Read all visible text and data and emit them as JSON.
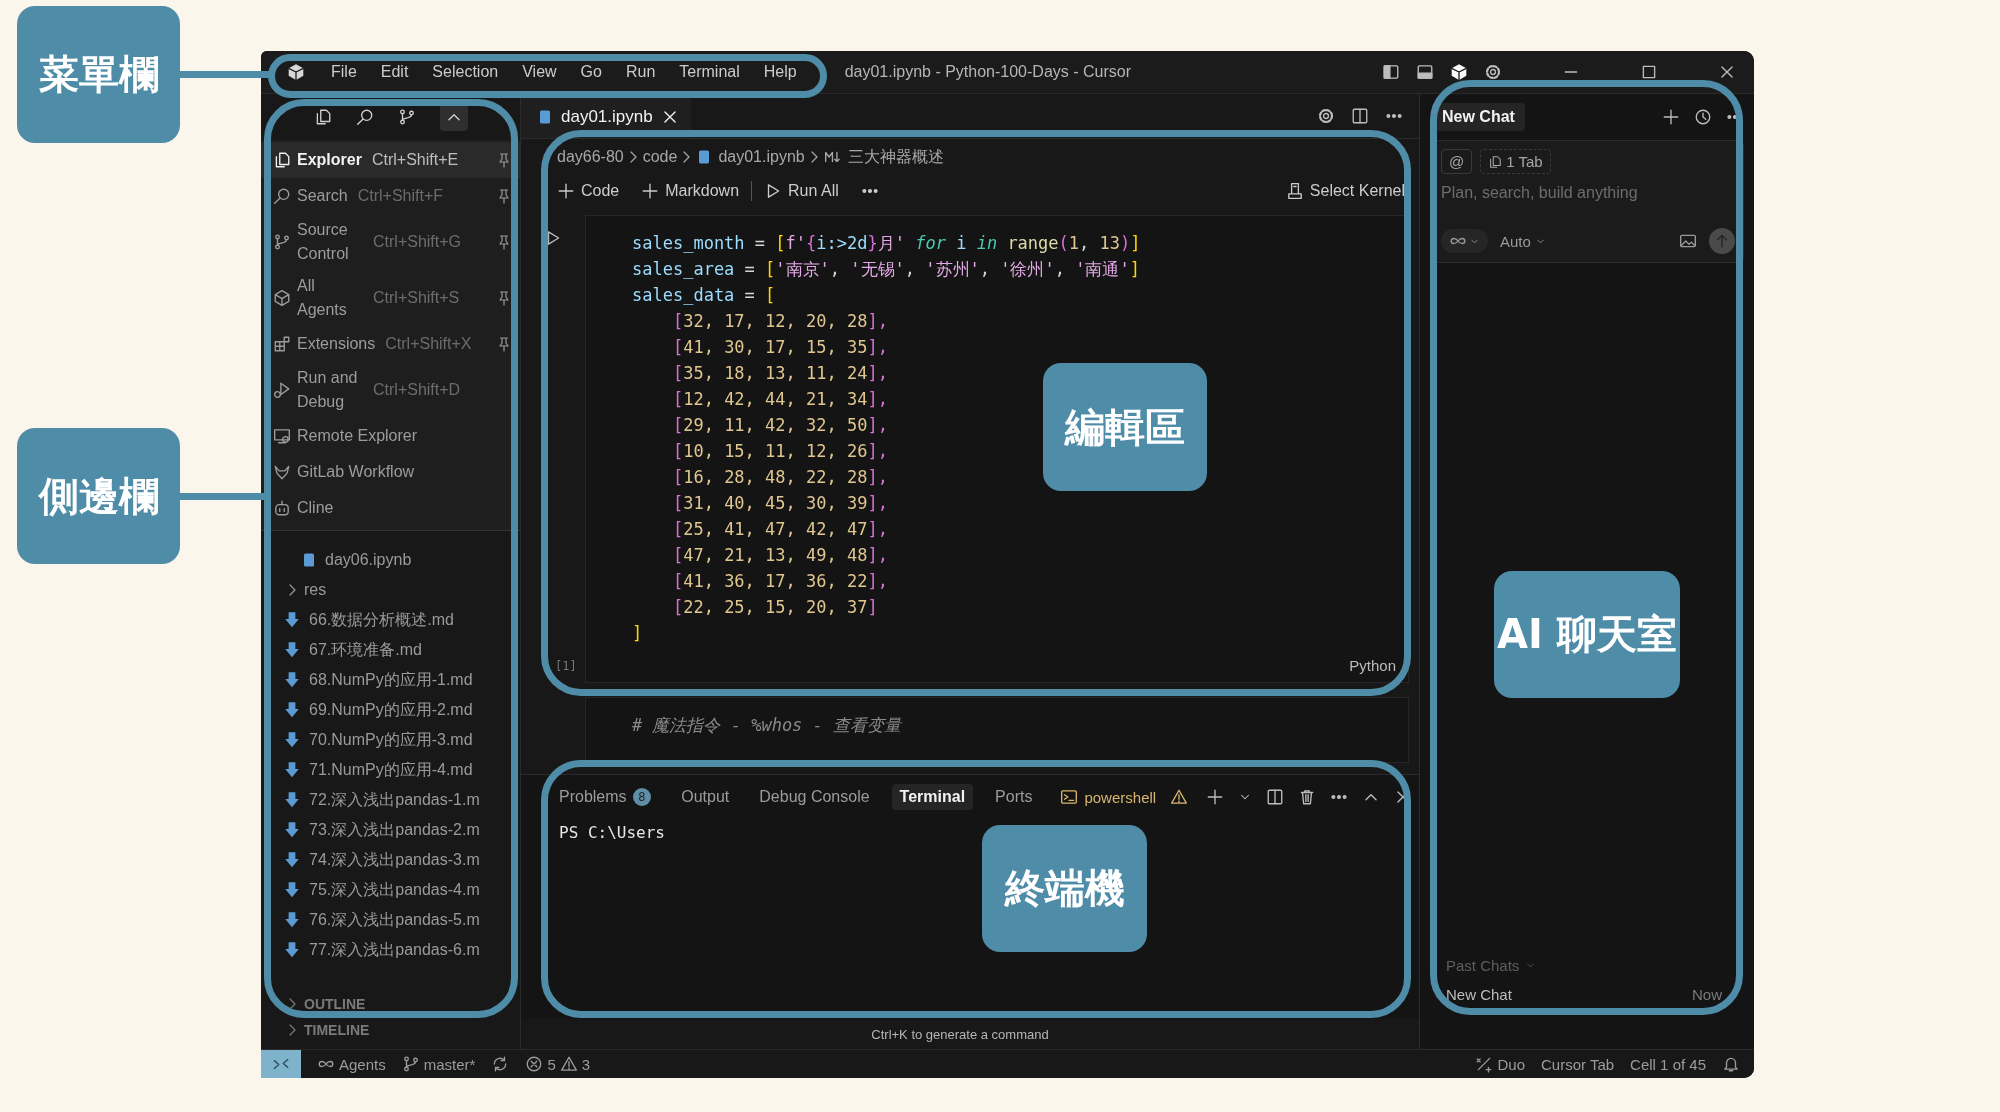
{
  "annotations": [
    {
      "label": "菜單欄"
    },
    {
      "label": "側邊欄"
    },
    {
      "label": "編輯區"
    },
    {
      "label": "終端機"
    },
    {
      "label": "AI 聊天室"
    }
  ],
  "title_bar": {
    "menus": [
      "File",
      "Edit",
      "Selection",
      "View",
      "Go",
      "Run",
      "Terminal",
      "Help"
    ],
    "title": "day01.ipynb - Python-100-Days - Cursor"
  },
  "sidebar": {
    "view_menu": [
      {
        "label": "Explorer",
        "shortcut": "Ctrl+Shift+E",
        "pinned": true,
        "selected": true
      },
      {
        "label": "Search",
        "shortcut": "Ctrl+Shift+F",
        "pinned": true,
        "selected": false
      },
      {
        "label": "Source Control",
        "shortcut": "Ctrl+Shift+G",
        "pinned": true,
        "selected": false
      },
      {
        "label": "All Agents",
        "shortcut": "Ctrl+Shift+S",
        "pinned": true,
        "selected": false
      },
      {
        "label": "Extensions",
        "shortcut": "Ctrl+Shift+X",
        "pinned": true,
        "selected": false
      },
      {
        "label": "Run and Debug",
        "shortcut": "Ctrl+Shift+D",
        "pinned": false,
        "selected": false
      },
      {
        "label": "Remote Explorer",
        "pinned": false,
        "selected": false
      },
      {
        "label": "GitLab Workflow",
        "pinned": false,
        "selected": false
      },
      {
        "label": "Cline",
        "pinned": false,
        "selected": false
      }
    ],
    "files": [
      {
        "name": "day06.ipynb",
        "kind": "notebook"
      },
      {
        "name": "res",
        "kind": "folder",
        "expanded": false
      },
      {
        "name": "66.数据分析概述.md",
        "kind": "markdown"
      },
      {
        "name": "67.环境准备.md",
        "kind": "markdown"
      },
      {
        "name": "68.NumPy的应用-1.md",
        "kind": "markdown"
      },
      {
        "name": "69.NumPy的应用-2.md",
        "kind": "markdown"
      },
      {
        "name": "70.NumPy的应用-3.md",
        "kind": "markdown"
      },
      {
        "name": "71.NumPy的应用-4.md",
        "kind": "markdown"
      },
      {
        "name": "72.深入浅出pandas-1.m",
        "kind": "markdown"
      },
      {
        "name": "73.深入浅出pandas-2.m",
        "kind": "markdown"
      },
      {
        "name": "74.深入浅出pandas-3.m",
        "kind": "markdown"
      },
      {
        "name": "75.深入浅出pandas-4.m",
        "kind": "markdown"
      },
      {
        "name": "76.深入浅出pandas-5.m",
        "kind": "markdown"
      },
      {
        "name": "77.深入浅出pandas-6.m",
        "kind": "markdown"
      }
    ],
    "sections": [
      {
        "label": "OUTLINE",
        "expanded": false
      },
      {
        "label": "TIMELINE",
        "expanded": false
      }
    ]
  },
  "editor": {
    "tabs": [
      {
        "label": "day01.ipynb",
        "selected": true
      }
    ],
    "breadcrumb": [
      {
        "text": "day66-80",
        "kind": "folder"
      },
      {
        "text": "code",
        "kind": "folder"
      },
      {
        "text": "day01.ipynb",
        "kind": "notebook"
      },
      {
        "text": "三大神器概述",
        "kind": "markdown"
      }
    ],
    "toolbar": {
      "add_code": "Code",
      "add_markdown": "Markdown",
      "run_all": "Run All",
      "kernel": "Select Kernel"
    },
    "cells": [
      {
        "execution": "[1]",
        "language": "Python",
        "lines": [
          [
            {
              "text": "sales_month",
              "kind": "var"
            },
            {
              "text": " = ",
              "kind": "op"
            },
            {
              "text": "[",
              "kind": "b1"
            },
            {
              "text": "f'",
              "kind": "str"
            },
            {
              "text": "{",
              "kind": "b2"
            },
            {
              "text": "i:>2d",
              "kind": "var"
            },
            {
              "text": "}",
              "kind": "b2"
            },
            {
              "text": "月' ",
              "kind": "str"
            },
            {
              "text": "for",
              "kind": "kw"
            },
            {
              "text": " i ",
              "kind": "var"
            },
            {
              "text": "in ",
              "kind": "kw"
            },
            {
              "text": "range",
              "kind": "fn"
            },
            {
              "text": "(",
              "kind": "b2"
            },
            {
              "text": "1",
              "kind": "num"
            },
            {
              "text": ", ",
              "kind": "op"
            },
            {
              "text": "13",
              "kind": "num"
            },
            {
              "text": ")",
              "kind": "b2"
            },
            {
              "text": "]",
              "kind": "b1"
            }
          ],
          [
            {
              "text": "sales_area",
              "kind": "var"
            },
            {
              "text": " = ",
              "kind": "op"
            },
            {
              "text": "[",
              "kind": "b1"
            },
            {
              "text": "'南京'",
              "kind": "str"
            },
            {
              "text": ", ",
              "kind": "op"
            },
            {
              "text": "'无锡'",
              "kind": "str"
            },
            {
              "text": ", ",
              "kind": "op"
            },
            {
              "text": "'苏州'",
              "kind": "str"
            },
            {
              "text": ", ",
              "kind": "op"
            },
            {
              "text": "'徐州'",
              "kind": "str"
            },
            {
              "text": ", ",
              "kind": "op"
            },
            {
              "text": "'南通'",
              "kind": "str"
            },
            {
              "text": "]",
              "kind": "b1"
            }
          ],
          [
            {
              "text": "sales_data",
              "kind": "var"
            },
            {
              "text": " = ",
              "kind": "op"
            },
            {
              "text": "[",
              "kind": "b1"
            }
          ],
          [
            {
              "text": "    [",
              "kind": "b2"
            },
            {
              "text": "32, 17, 12, 20, 28",
              "kind": "num"
            },
            {
              "text": "],",
              "kind": "b2"
            }
          ],
          [
            {
              "text": "    [",
              "kind": "b2"
            },
            {
              "text": "41, 30, 17, 15, 35",
              "kind": "num"
            },
            {
              "text": "],",
              "kind": "b2"
            }
          ],
          [
            {
              "text": "    [",
              "kind": "b2"
            },
            {
              "text": "35, 18, 13, 11, 24",
              "kind": "num"
            },
            {
              "text": "],",
              "kind": "b2"
            }
          ],
          [
            {
              "text": "    [",
              "kind": "b2"
            },
            {
              "text": "12, 42, 44, 21, 34",
              "kind": "num"
            },
            {
              "text": "],",
              "kind": "b2"
            }
          ],
          [
            {
              "text": "    [",
              "kind": "b2"
            },
            {
              "text": "29, 11, 42, 32, 50",
              "kind": "num"
            },
            {
              "text": "],",
              "kind": "b2"
            }
          ],
          [
            {
              "text": "    [",
              "kind": "b2"
            },
            {
              "text": "10, 15, 11, 12, 26",
              "kind": "num"
            },
            {
              "text": "],",
              "kind": "b2"
            }
          ],
          [
            {
              "text": "    [",
              "kind": "b2"
            },
            {
              "text": "16, 28, 48, 22, 28",
              "kind": "num"
            },
            {
              "text": "],",
              "kind": "b2"
            }
          ],
          [
            {
              "text": "    [",
              "kind": "b2"
            },
            {
              "text": "31, 40, 45, 30, 39",
              "kind": "num"
            },
            {
              "text": "],",
              "kind": "b2"
            }
          ],
          [
            {
              "text": "    [",
              "kind": "b2"
            },
            {
              "text": "25, 41, 47, 42, 47",
              "kind": "num"
            },
            {
              "text": "],",
              "kind": "b2"
            }
          ],
          [
            {
              "text": "    [",
              "kind": "b2"
            },
            {
              "text": "47, 21, 13, 49, 48",
              "kind": "num"
            },
            {
              "text": "],",
              "kind": "b2"
            }
          ],
          [
            {
              "text": "    [",
              "kind": "b2"
            },
            {
              "text": "41, 36, 17, 36, 22",
              "kind": "num"
            },
            {
              "text": "],",
              "kind": "b2"
            }
          ],
          [
            {
              "text": "    [",
              "kind": "b2"
            },
            {
              "text": "22, 25, 15, 20, 37",
              "kind": "num"
            },
            {
              "text": "]",
              "kind": "b2"
            }
          ],
          [
            {
              "text": "]",
              "kind": "b1"
            }
          ]
        ]
      },
      {
        "lines": [
          [
            {
              "text": "# 魔法指令 - %whos - 查看变量",
              "kind": "comment"
            }
          ]
        ]
      }
    ]
  },
  "panel": {
    "tabs": [
      {
        "label": "Problems",
        "badge": "8",
        "selected": false
      },
      {
        "label": "Output",
        "selected": false
      },
      {
        "label": "Debug Console",
        "selected": false
      },
      {
        "label": "Terminal",
        "selected": true
      },
      {
        "label": "Ports",
        "selected": false
      }
    ],
    "shell": "powershell",
    "terminal_lines": [
      "PS C:\\Users"
    ],
    "hint": "Ctrl+K to generate a command"
  },
  "chat": {
    "tab": "New Chat",
    "mention": "@",
    "context_chip": "1 Tab",
    "placeholder": "Plan, search, build anything",
    "mode": "Auto",
    "past_chats_label": "Past Chats",
    "past_chats": [
      {
        "title": "New Chat",
        "time": "Now"
      }
    ]
  },
  "status_bar": {
    "agents": "Agents",
    "branch": "master*",
    "errors": "5",
    "warnings": "3",
    "right": [
      "Duo",
      "Cursor Tab",
      "Cell 1 of 45"
    ]
  }
}
